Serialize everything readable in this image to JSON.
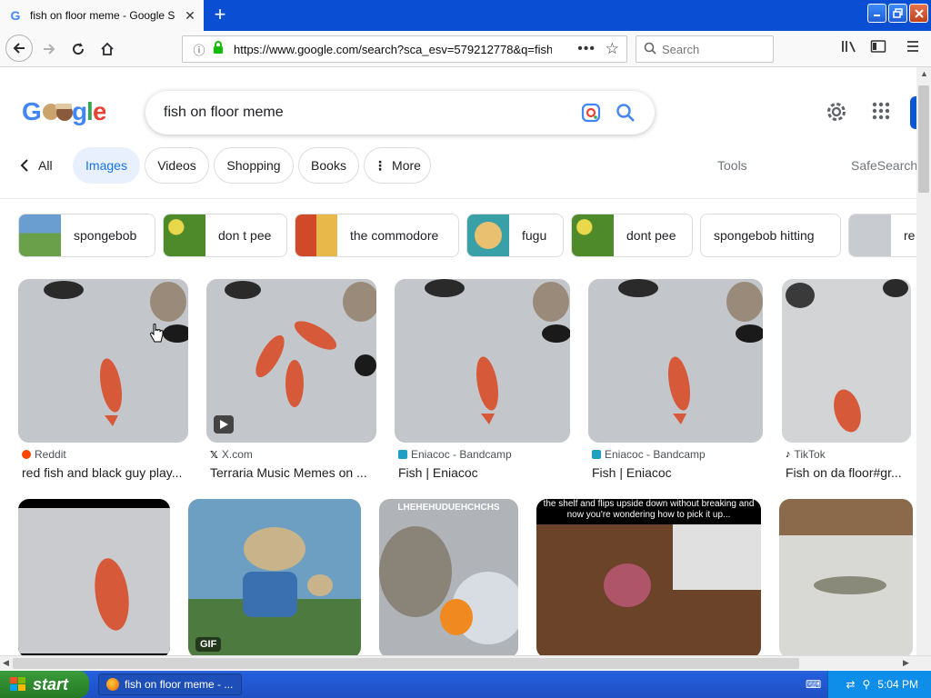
{
  "browser": {
    "tab_title": "fish on floor meme - Google Search",
    "tab_close": "✕",
    "new_tab": "+",
    "url": "https://www.google.com/search?sca_esv=579212778&q=fish",
    "search_placeholder": "Search"
  },
  "google": {
    "query": "fish on floor meme",
    "tabs": [
      {
        "label": "All"
      },
      {
        "label": "Images"
      },
      {
        "label": "Videos"
      },
      {
        "label": "Shopping"
      },
      {
        "label": "Books"
      },
      {
        "label": "More"
      }
    ],
    "tools": "Tools",
    "safesearch": "SafeSearch",
    "related": [
      {
        "label": "spongebob"
      },
      {
        "label": "don t pee"
      },
      {
        "label": "the commodore"
      },
      {
        "label": "fugu"
      },
      {
        "label": "dont pee"
      },
      {
        "label": "spongebob hitting"
      },
      {
        "label": "re"
      }
    ],
    "results": [
      {
        "source": "Reddit",
        "title": "red fish and black guy play..."
      },
      {
        "source": "X.com",
        "title": "Terraria Music Memes on ..."
      },
      {
        "source": "Eniacoc - Bandcamp",
        "title": "Fish | Eniacoc"
      },
      {
        "source": "Eniacoc - Bandcamp",
        "title": "Fish | Eniacoc"
      },
      {
        "source": "TikTok",
        "title": "Fish on da floor#gr..."
      }
    ],
    "row2": {
      "gif_badge": "GIF",
      "meme_top_text": "LHEHEHUDUEHCHCHS",
      "meme_caption": "the shelf and flips upside down without breaking and now you're wondering how to pick it up..."
    }
  },
  "taskbar": {
    "start": "start",
    "task": "fish on floor meme - ...",
    "clock": "5:04 PM"
  },
  "colors": {
    "accent": "#1a73e8",
    "xp_blue": "#245edb",
    "xp_green": "#2f8a2f"
  }
}
